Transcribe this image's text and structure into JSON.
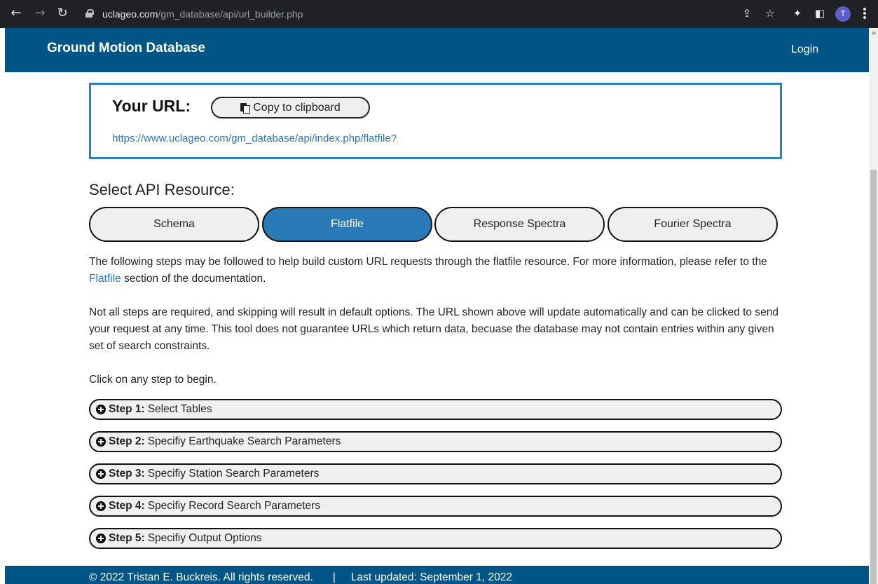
{
  "browser": {
    "url_host": "uclageo.com",
    "url_path": "/gm_database/api/url_builder.php",
    "profile_initial": "T"
  },
  "header": {
    "brand": "Ground Motion Database",
    "login": "Login"
  },
  "url_box": {
    "label": "Your URL:",
    "copy_label": "Copy to clipboard",
    "url": "https://www.uclageo.com/gm_database/api/index.php/flatfile?"
  },
  "resources": {
    "title": "Select API Resource:",
    "buttons": [
      {
        "label": "Schema",
        "active": false
      },
      {
        "label": "Flatfile",
        "active": true
      },
      {
        "label": "Response Spectra",
        "active": false
      },
      {
        "label": "Fourier Spectra",
        "active": false
      }
    ]
  },
  "intro": {
    "p1_before": "The following steps may be followed to help build custom URL requests through the flatfile resource. For more information, please refer to the ",
    "p1_link": "Flatfile",
    "p1_after": " section of the documentation.",
    "p2": "Not all steps are required, and skipping will result in default options. The URL shown above will update automatically and can be clicked to send your request at any time. This tool does not guarantee URLs which return data, becuase the database may not contain entries within any given set of search constraints.",
    "p3": "Click on any step to begin."
  },
  "steps": [
    {
      "num": "Step 1:",
      "label": "Select Tables"
    },
    {
      "num": "Step 2:",
      "label": "Specifiy Earthquake Search Parameters"
    },
    {
      "num": "Step 3:",
      "label": "Specifiy Station Search Parameters"
    },
    {
      "num": "Step 4:",
      "label": "Specifiy Record Search Parameters"
    },
    {
      "num": "Step 5:",
      "label": "Specifiy Output Options"
    }
  ],
  "footer": {
    "copyright": "© 2022 Tristan E. Buckreis. All rights reserved.",
    "separator": "|",
    "updated": "Last updated: September 1, 2022"
  },
  "colors": {
    "header_bg": "#005587",
    "active_button": "#2b7ab8",
    "link": "#2a74c9",
    "url_box_border": "#2d82bc"
  }
}
